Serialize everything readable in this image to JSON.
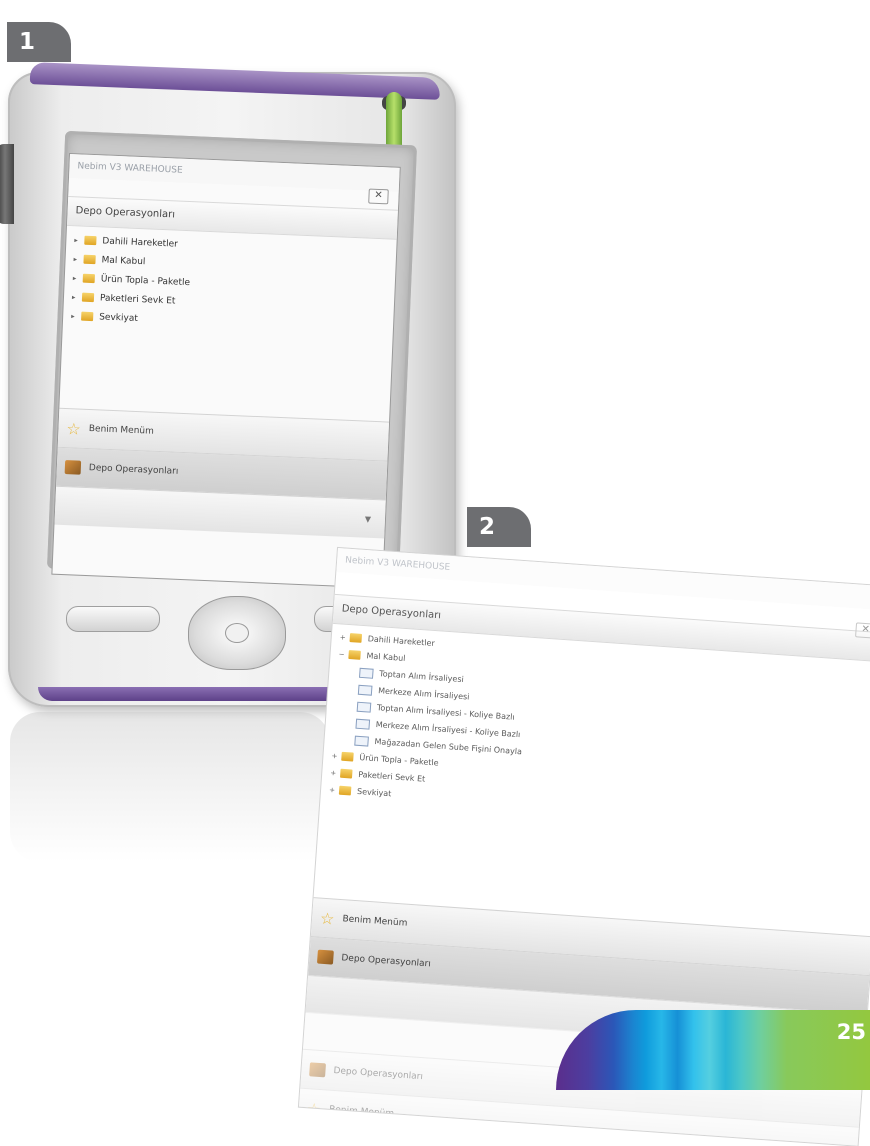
{
  "badges": {
    "step1": "1",
    "step2": "2"
  },
  "screen1": {
    "window_title": "Nebim V3 WAREHOUSE",
    "close": "✕",
    "section_header": "Depo Operasyonları",
    "tree": [
      "Dahili Hareketler",
      "Mal Kabul",
      "Ürün Topla - Paketle",
      "Paketleri Sevk Et",
      "Sevkiyat"
    ],
    "nav_buttons": [
      {
        "label": "Benim Menüm",
        "icon": "star-icon"
      },
      {
        "label": "Depo Operasyonları",
        "icon": "warehouse-ops-icon"
      }
    ],
    "scroll_arrow": "▼"
  },
  "screen2": {
    "window_title": "Nebim V3 WAREHOUSE",
    "close": "✕",
    "section_header": "Depo Operasyonları",
    "tree": [
      {
        "label": "Dahili Hareketler",
        "level": 0,
        "expander": "+"
      },
      {
        "label": "Mal Kabul",
        "level": 0,
        "expander": "−"
      },
      {
        "label": "Toptan Alım İrsaliyesi",
        "level": 1
      },
      {
        "label": "Merkeze Alım İrsaliyesi",
        "level": 1
      },
      {
        "label": "Toptan Alım İrsaliyesi - Koliye Bazlı",
        "level": 1
      },
      {
        "label": "Merkeze Alım İrsaliyesi - Koliye Bazlı",
        "level": 1
      },
      {
        "label": "Mağazadan Gelen Sube Fişini Onayla",
        "level": 1
      },
      {
        "label": "Ürün Topla - Paketle",
        "level": 0,
        "expander": "+"
      },
      {
        "label": "Paketleri Sevk Et",
        "level": 0,
        "expander": "+"
      },
      {
        "label": "Sevkiyat",
        "level": 0,
        "expander": "+"
      }
    ],
    "nav_buttons": [
      {
        "label": "Benim Menüm",
        "icon": "star-icon"
      },
      {
        "label": "Depo Operasyonları",
        "icon": "warehouse-ops-icon"
      }
    ],
    "faded_buttons": [
      {
        "label": "Depo Operasyonları",
        "icon": "warehouse-ops-icon"
      },
      {
        "label": "Benim Menüm",
        "icon": "star-icon"
      }
    ],
    "scroll_arrow": "▼"
  },
  "page_number": "25"
}
